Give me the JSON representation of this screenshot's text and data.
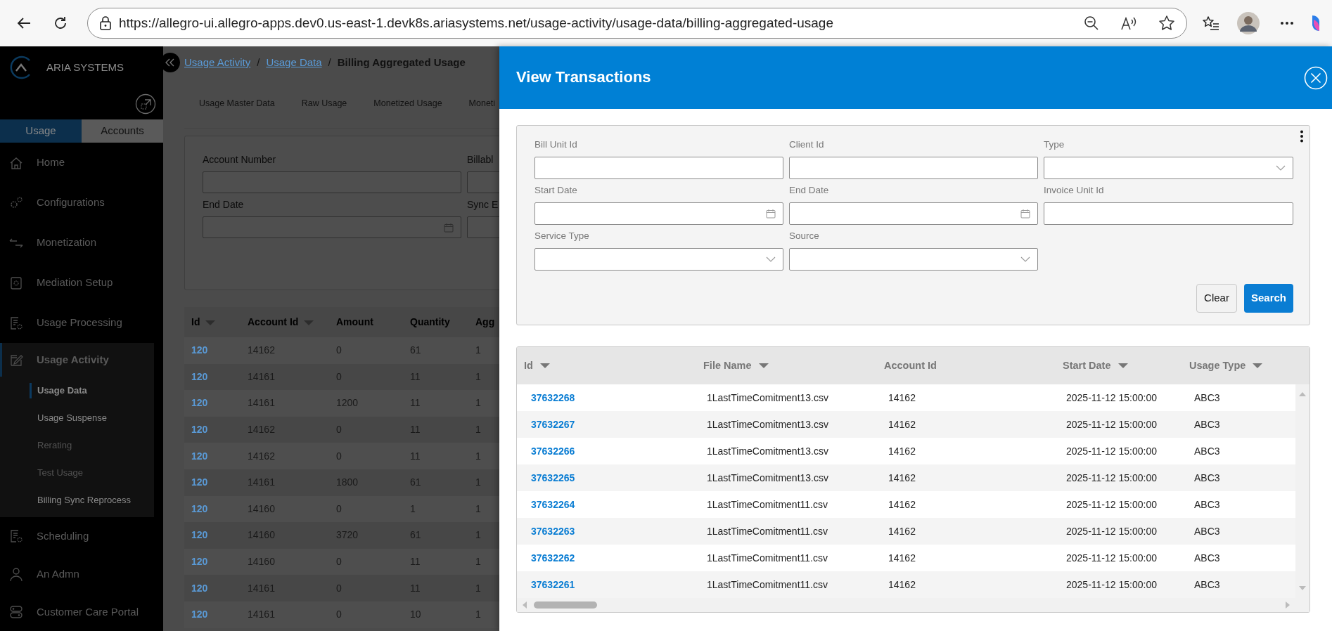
{
  "browser": {
    "url": "https://allegro-ui.allegro-apps.dev0.us-east-1.devk8s.ariasystems.net/usage-activity/usage-data/billing-aggregated-usage"
  },
  "sidebar": {
    "brand": "ARIA SYSTEMS",
    "tabs": [
      {
        "label": "Usage",
        "selected": true
      },
      {
        "label": "Accounts",
        "selected": false
      }
    ],
    "items": [
      {
        "label": "Home",
        "selected": false,
        "expanded": false
      },
      {
        "label": "Configurations",
        "selected": false,
        "expanded": false
      },
      {
        "label": "Monetization",
        "selected": false,
        "expanded": false
      },
      {
        "label": "Mediation Setup",
        "selected": false,
        "expanded": false
      },
      {
        "label": "Usage Processing",
        "selected": false,
        "expanded": false
      },
      {
        "label": "Usage Activity",
        "selected": true,
        "expanded": true,
        "children": [
          {
            "label": "Usage Data",
            "selected": true,
            "disabled": false
          },
          {
            "label": "Usage Suspense",
            "selected": false,
            "disabled": false
          },
          {
            "label": "Rerating",
            "selected": false,
            "disabled": true
          },
          {
            "label": "Test Usage",
            "selected": false,
            "disabled": true
          },
          {
            "label": "Billing Sync Reprocess",
            "selected": false,
            "disabled": false
          }
        ]
      },
      {
        "label": "Scheduling",
        "selected": false,
        "expanded": false
      },
      {
        "label": "An Admn",
        "selected": false,
        "expanded": false
      },
      {
        "label": "Customer Care Portal",
        "selected": false,
        "expanded": false
      }
    ]
  },
  "page": {
    "breadcrumb": {
      "items": [
        "Usage Activity",
        "Usage Data",
        "Billing Aggregated Usage"
      ],
      "separator": "/"
    },
    "tabs": [
      "Usage Master Data",
      "Raw Usage",
      "Monetized Usage",
      "Moneti"
    ],
    "filters": [
      {
        "label": "Account Number",
        "kind": "text"
      },
      {
        "label": "Billabl",
        "kind": "text"
      },
      {
        "label": "End Date",
        "kind": "date"
      },
      {
        "label": "Sync E",
        "kind": "text"
      }
    ],
    "table": {
      "columns": [
        {
          "label": "Id",
          "sortable": true
        },
        {
          "label": "Account Id",
          "sortable": true
        },
        {
          "label": "Amount",
          "sortable": false
        },
        {
          "label": "Quantity",
          "sortable": false
        },
        {
          "label": "Agg",
          "sortable": false
        }
      ],
      "rows": [
        [
          "120",
          "14162",
          "0",
          "61",
          "1"
        ],
        [
          "120",
          "14161",
          "0",
          "11",
          "1"
        ],
        [
          "120",
          "14161",
          "1200",
          "11",
          "1"
        ],
        [
          "120",
          "14162",
          "0",
          "11",
          "1"
        ],
        [
          "120",
          "14162",
          "0",
          "11",
          "1"
        ],
        [
          "120",
          "14161",
          "1800",
          "61",
          "1"
        ],
        [
          "120",
          "14160",
          "0",
          "1",
          "1"
        ],
        [
          "120",
          "14160",
          "3720",
          "61",
          "1"
        ],
        [
          "120",
          "14160",
          "0",
          "11",
          "1"
        ],
        [
          "120",
          "14161",
          "0",
          "11",
          "1"
        ],
        [
          "120",
          "14161",
          "0",
          "10",
          "1"
        ]
      ]
    }
  },
  "modal": {
    "title": "View Transactions",
    "filters": [
      {
        "label": "Bill Unit Id",
        "kind": "text"
      },
      {
        "label": "Client Id",
        "kind": "text"
      },
      {
        "label": "Type",
        "kind": "select"
      },
      {
        "label": "Start Date",
        "kind": "date"
      },
      {
        "label": "End Date",
        "kind": "date"
      },
      {
        "label": "Invoice Unit Id",
        "kind": "text"
      },
      {
        "label": "Service Type",
        "kind": "select"
      },
      {
        "label": "Source",
        "kind": "select"
      }
    ],
    "buttons": [
      {
        "label": "Clear",
        "kind": "secondary"
      },
      {
        "label": "Search",
        "kind": "primary"
      }
    ],
    "table": {
      "columns": [
        {
          "label": "Id",
          "sortable": true
        },
        {
          "label": "File Name",
          "sortable": true
        },
        {
          "label": "Account Id",
          "sortable": false
        },
        {
          "label": "Start Date",
          "sortable": true
        },
        {
          "label": "Usage Type",
          "sortable": true
        }
      ],
      "rows": [
        [
          "37632268",
          "1LastTimeComitment13.csv",
          "14162",
          "2025-11-12 15:00:00",
          "ABC3"
        ],
        [
          "37632267",
          "1LastTimeComitment13.csv",
          "14162",
          "2025-11-12 15:00:00",
          "ABC3"
        ],
        [
          "37632266",
          "1LastTimeComitment13.csv",
          "14162",
          "2025-11-12 15:00:00",
          "ABC3"
        ],
        [
          "37632265",
          "1LastTimeComitment13.csv",
          "14162",
          "2025-11-12 15:00:00",
          "ABC3"
        ],
        [
          "37632264",
          "1LastTimeComitment11.csv",
          "14162",
          "2025-11-12 15:00:00",
          "ABC3"
        ],
        [
          "37632263",
          "1LastTimeComitment11.csv",
          "14162",
          "2025-11-12 15:00:00",
          "ABC3"
        ],
        [
          "37632262",
          "1LastTimeComitment11.csv",
          "14162",
          "2025-11-12 15:00:00",
          "ABC3"
        ],
        [
          "37632261",
          "1LastTimeComitment11.csv",
          "14162",
          "2025-11-12 15:00:00",
          "ABC3"
        ]
      ]
    }
  }
}
